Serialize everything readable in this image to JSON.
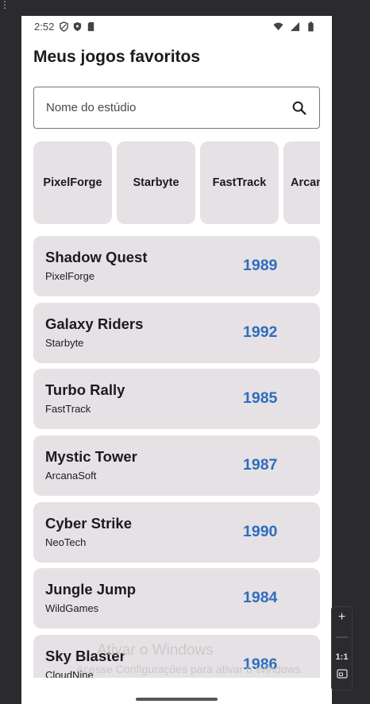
{
  "host": {
    "menu_glyph": "⋮"
  },
  "status_bar": {
    "time": "2:52",
    "left_icons": [
      "shield-outline-icon",
      "shield-filled-icon",
      "sd-card-icon"
    ],
    "right_icons": [
      "wifi-icon",
      "signal-icon",
      "battery-icon"
    ]
  },
  "page": {
    "title": "Meus jogos favoritos"
  },
  "search": {
    "placeholder": "Nome do estúdio",
    "value": "",
    "icon": "search-icon"
  },
  "studios": [
    "PixelForge",
    "Starbyte",
    "FastTrack",
    "ArcanaSoft"
  ],
  "games": [
    {
      "name": "Shadow Quest",
      "studio": "PixelForge",
      "year": "1989"
    },
    {
      "name": "Galaxy Riders",
      "studio": "Starbyte",
      "year": "1992"
    },
    {
      "name": "Turbo Rally",
      "studio": "FastTrack",
      "year": "1985"
    },
    {
      "name": "Mystic Tower",
      "studio": "ArcanaSoft",
      "year": "1987"
    },
    {
      "name": "Cyber Strike",
      "studio": "NeoTech",
      "year": "1990"
    },
    {
      "name": "Jungle Jump",
      "studio": "WildGames",
      "year": "1984"
    },
    {
      "name": "Sky Blaster",
      "studio": "CloudNine",
      "year": "1986"
    }
  ],
  "colors": {
    "accent_year": "#2e6dbf",
    "card_bg": "#e6e1e5",
    "host_bg": "#2b2b2f"
  },
  "watermark": {
    "title": "Ativar o Windows",
    "subtitle": "Acesse Configurações para ativar o Windows."
  },
  "emulator_controls": {
    "zoom_in": "+",
    "zoom_out": "—",
    "ratio": "1:1"
  }
}
